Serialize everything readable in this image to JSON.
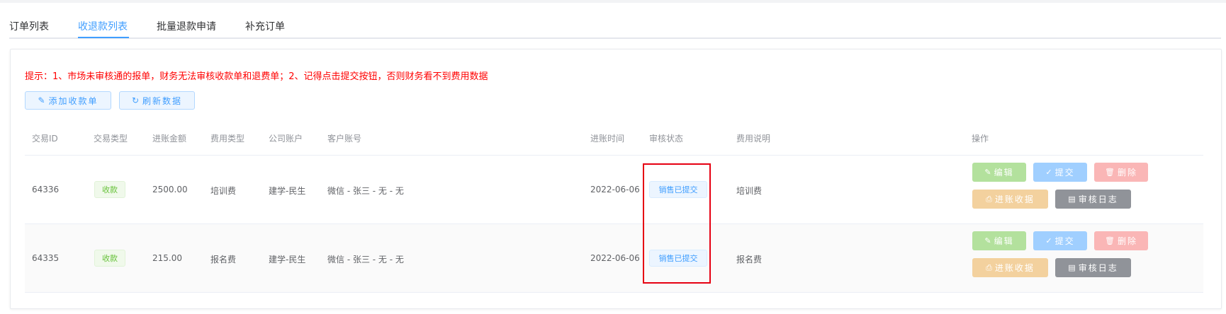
{
  "tabs": [
    {
      "label": "订单列表"
    },
    {
      "label": "收退款列表",
      "active": true
    },
    {
      "label": "批量退款申请"
    },
    {
      "label": "补充订单"
    }
  ],
  "notice": "提示：1、市场未审核通的报单，财务无法审核收款单和退费单；2、记得点击提交按钮，否则财务看不到费用数据",
  "toolbar": {
    "add_label": "添加收款单",
    "refresh_label": "刷新数据"
  },
  "table": {
    "columns": [
      "交易ID",
      "交易类型",
      "进账金额",
      "费用类型",
      "公司账户",
      "客户账号",
      "进账时间",
      "审核状态",
      "费用说明",
      "操作"
    ],
    "rows": [
      {
        "id": "64336",
        "type": "收款",
        "amount": "2500.00",
        "fee_type": "培训费",
        "company_account": "建学-民生",
        "customer_account": "微信 - 张三 - 无 - 无",
        "time": "2022-06-06",
        "status": "销售已提交",
        "description": "培训费"
      },
      {
        "id": "64335",
        "type": "收款",
        "amount": "215.00",
        "fee_type": "报名费",
        "company_account": "建学-民生",
        "customer_account": "微信 - 张三 - 无 - 无",
        "time": "2022-06-06",
        "status": "销售已提交",
        "description": "报名费"
      }
    ]
  },
  "actions": {
    "edit": "编辑",
    "submit": "提交",
    "delete": "删除",
    "income": "进账收据",
    "log": "审核日志"
  },
  "icons": {
    "add": "edit-pen-icon",
    "refresh": "refresh-icon",
    "edit": "edit-pen-icon",
    "submit": "check-icon",
    "delete": "trash-icon",
    "income": "printer-icon",
    "log": "document-icon"
  },
  "colors": {
    "primary": "#409eff",
    "notice": "#ff0000",
    "success": "#67c23a",
    "highlight_box": "#e60012"
  }
}
